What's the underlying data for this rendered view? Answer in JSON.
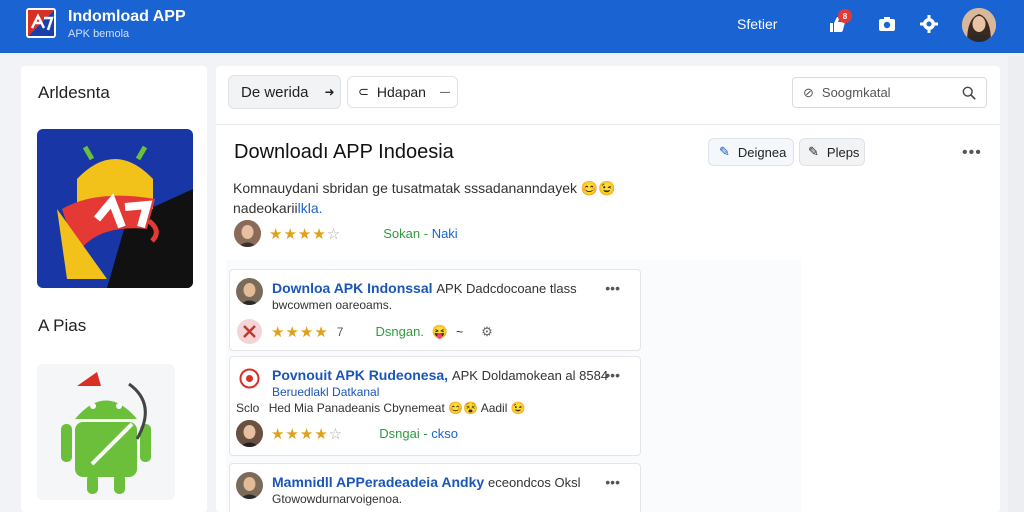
{
  "header": {
    "title": "Indomload APP",
    "subtitle": "APK bemola",
    "link": "Sfetier",
    "notif_count": "8"
  },
  "sidebar": {
    "title": "Arldesnta",
    "section": "A Pias"
  },
  "toolbar": {
    "btn_primary": "De werida",
    "btn_secondary": "Hdapan",
    "search_placeholder": "Soogmkatal"
  },
  "main": {
    "title": "Downloadı APP Indoesia",
    "btn_design": "Deignea",
    "btn_pleps": "Pleps",
    "desc_line1": "Komnauydani sbridan ge tusatmatak sssadananndayek",
    "desc_line2a": "nadeokarii",
    "desc_line2b": "lkla.",
    "desc_emoji": "😊😉",
    "rating_stars": "★★★★",
    "rating_empty": "☆",
    "rating_text": "Sokan",
    "rating_sep": " - ",
    "rating_link": "Naki"
  },
  "cards": [
    {
      "title": "Downloa APK Indonssal",
      "title_rest": "APK Dadcdocoane tlass",
      "sub": "bwcowmen oareoams.",
      "stars": "★★★★",
      "star_extra": "7",
      "status": "Dsngan.",
      "emoji": "😝",
      "tail": "~",
      "more": "•••"
    },
    {
      "title": "Povnouit APK Rudeonesa,",
      "title_rest": "APK Doldamokean al 8584",
      "sub": "Beruedlakl Datkanal",
      "sub2_label": "Sclo",
      "sub2": "Hed Mia Panadeanis Cbynemeat",
      "emoji": "😊😵 Aadil 😉",
      "stars": "★★★★",
      "star_empty": "☆",
      "status": "Dsngai",
      "status_sep": " - ",
      "status_tail": "ckso",
      "more": "•••"
    },
    {
      "title": "Mamnidll APPeradeadeia Andky",
      "title_rest": "eceondcos Oksl",
      "sub": "Gtowowdurnarvoigenoa.",
      "more": "•••"
    }
  ],
  "colors": {
    "header_bg": "#1a63d2",
    "accent_blue": "#1a56b8",
    "star": "#e0a11b",
    "green": "#2e9d3f"
  }
}
